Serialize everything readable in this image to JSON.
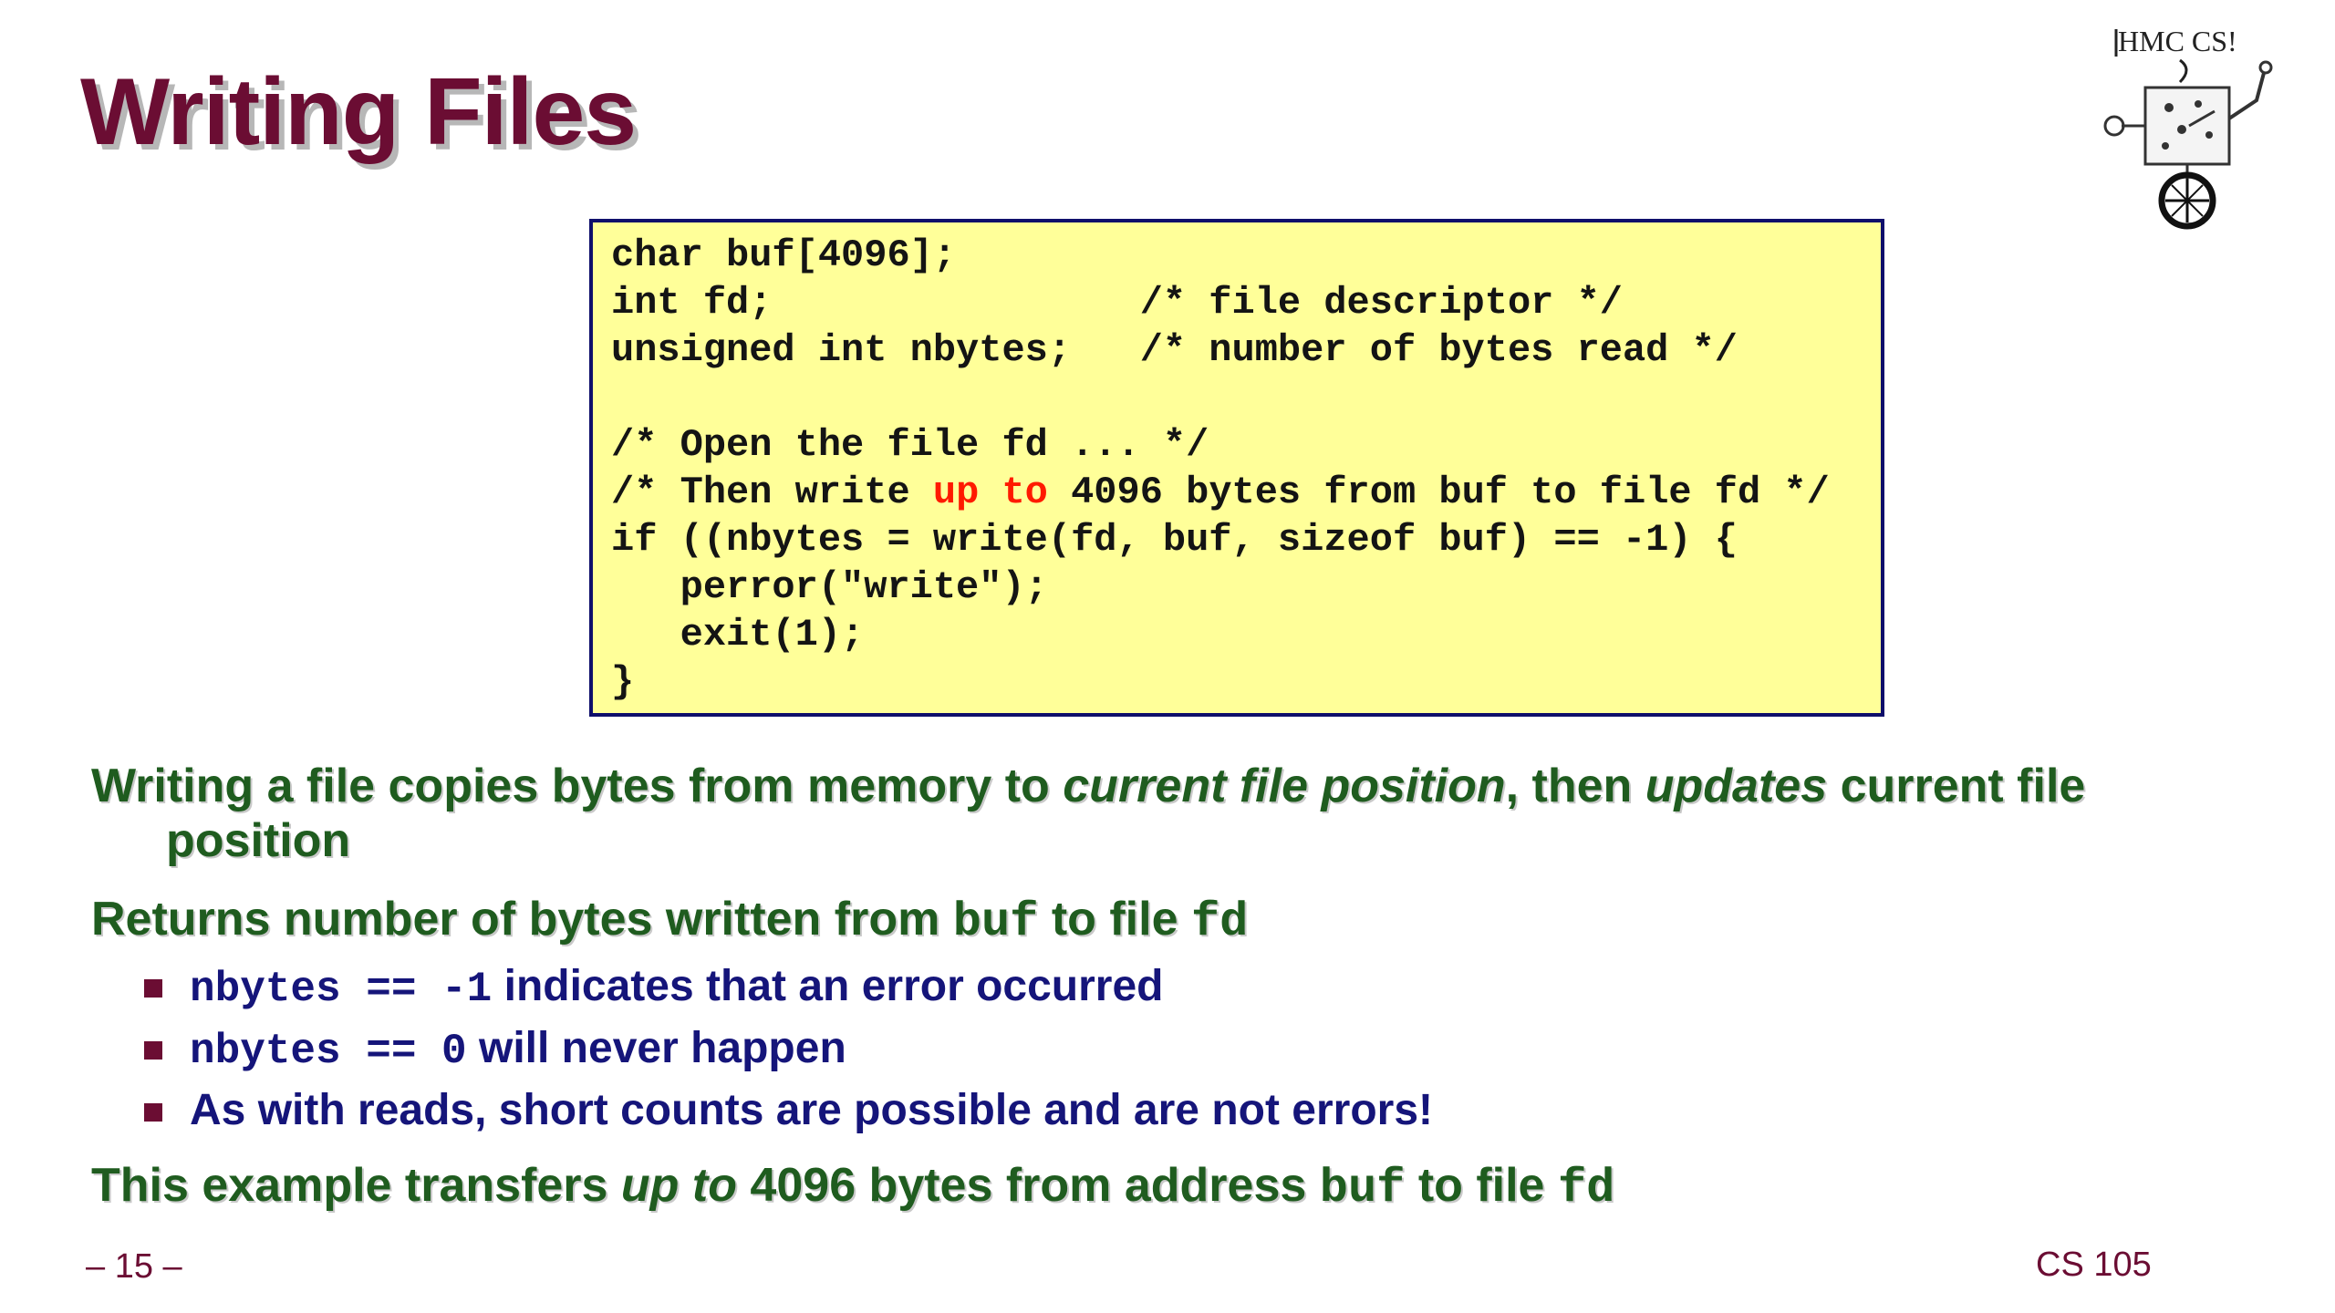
{
  "slide": {
    "title": "Writing Files",
    "page_number": "– 15 –",
    "course": "CS 105"
  },
  "logo": {
    "label": "HMC CS!"
  },
  "code": {
    "line1": "char buf[4096];",
    "line2": "int fd;                /* file descriptor */",
    "line3": "unsigned int nbytes;   /* number of bytes read */",
    "line5": "/* Open the file fd ... */",
    "line6_before": "/* Then write ",
    "line6_highlight": "up to",
    "line6_after": " 4096 bytes from buf to file fd */",
    "line7": "if ((nbytes = write(fd, buf, sizeof buf) == -1) {",
    "line8": "   perror(\"write\");",
    "line9": "   exit(1);",
    "line10": "}"
  },
  "points": {
    "p1": {
      "text_a": "Writing a file copies bytes from memory to ",
      "em_a": "current file position",
      "text_b": ", then ",
      "em_b": "updates",
      "text_c": " current file",
      "text_cont": "position"
    },
    "p2": {
      "text_a": "Returns number of bytes written from ",
      "code_a": "buf",
      "text_b": " to file ",
      "code_b": "fd"
    },
    "sub1": {
      "code": "nbytes == -1",
      "text": " indicates that an error occurred"
    },
    "sub2": {
      "code": "nbytes == 0",
      "text": " will never happen"
    },
    "sub3": {
      "text": "As with reads, short counts are possible and are not errors!"
    },
    "p3": {
      "text_a": "This example transfers ",
      "em_a": "up to",
      "text_b": " 4096 bytes from address ",
      "code_a": "buf",
      "text_c": " to file ",
      "code_b": "fd"
    }
  }
}
